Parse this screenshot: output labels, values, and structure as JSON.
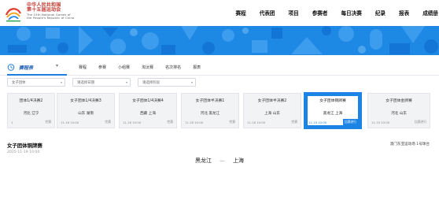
{
  "header": {
    "logo_lines": [
      "中华人民共和国",
      "第十五届运动会",
      "The 15th National Games of",
      "the People's Republic of China"
    ],
    "nav": [
      "赛程",
      "代表团",
      "项目",
      "参赛者",
      "每日决赛",
      "纪录",
      "报表",
      "成绩册"
    ]
  },
  "tabs": {
    "live_label": "赛程表",
    "items": [
      "赛程",
      "参赛",
      "小组赛",
      "淘汰赛",
      "名次排名",
      "报表"
    ]
  },
  "filters": [
    {
      "value": "女子团体"
    },
    {
      "value": "请选择日期"
    },
    {
      "value": "请选择阶段"
    }
  ],
  "cards": [
    {
      "title": "团体1/4决赛2",
      "teams": "河北  辽宁",
      "date": "1",
      "status": "完赛"
    },
    {
      "title": "女子团体1/4决赛3",
      "teams": "山东  湖南",
      "date": "11-16 10:00",
      "status": "完赛"
    },
    {
      "title": "女子团体1/4决赛4",
      "teams": "西藏  上海",
      "date": "11-16 10:00",
      "status": "完赛"
    },
    {
      "title": "女子团体半决赛1",
      "teams": "河北  黑龙江",
      "date": "11-18 10:00",
      "status": "完赛"
    },
    {
      "title": "女子团体半决赛2",
      "teams": "上海  山东",
      "date": "11-18 10:00",
      "status": "完赛"
    },
    {
      "title": "女子团体铜牌赛",
      "teams": "黑龙江  上海",
      "date": "11-19 10:00",
      "status": "比赛进行"
    },
    {
      "title": "女子团体金牌赛",
      "teams": "河北  山东",
      "date": "11-19 10:00",
      "status": "比赛进行"
    }
  ],
  "detail": {
    "title": "女子团体铜牌赛",
    "time": "2025-11-19 10:00",
    "venue": "澳门东亚运动场 1号球台",
    "team_a": "黑龙江",
    "team_b": "上海",
    "separator": "—"
  },
  "colors": {
    "brand_blue": "#1c84e4",
    "logo_red": "#c23a31"
  }
}
